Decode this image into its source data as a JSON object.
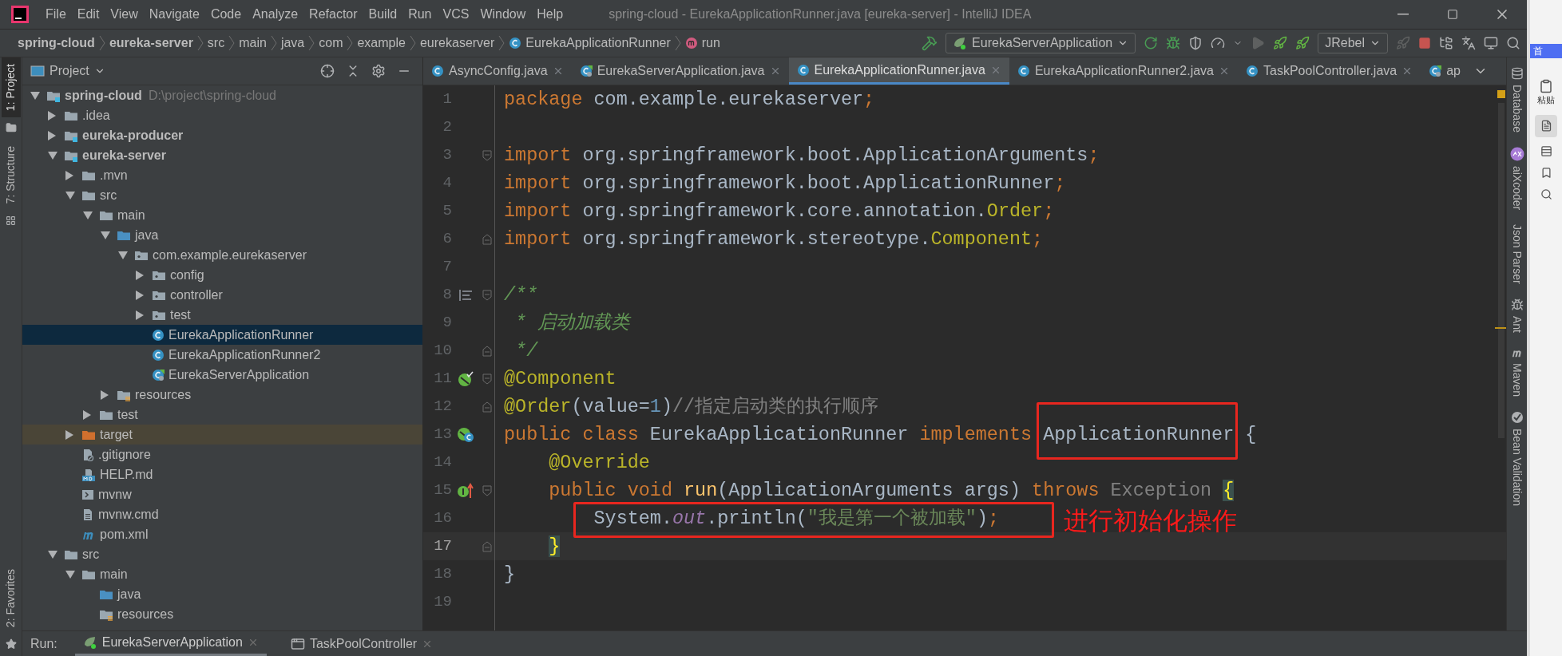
{
  "window": {
    "title": "spring-cloud - EurekaApplicationRunner.java [eureka-server] - IntelliJ IDEA"
  },
  "menu": [
    "File",
    "Edit",
    "View",
    "Navigate",
    "Code",
    "Analyze",
    "Refactor",
    "Build",
    "Run",
    "VCS",
    "Window",
    "Help"
  ],
  "breadcrumbs": [
    {
      "label": "spring-cloud",
      "kind": "module"
    },
    {
      "label": "eureka-server",
      "kind": "module"
    },
    {
      "label": "src",
      "kind": "dir"
    },
    {
      "label": "main",
      "kind": "dir"
    },
    {
      "label": "java",
      "kind": "dir"
    },
    {
      "label": "com",
      "kind": "dir"
    },
    {
      "label": "example",
      "kind": "dir"
    },
    {
      "label": "eurekaserver",
      "kind": "dir"
    },
    {
      "label": "EurekaApplicationRunner",
      "kind": "class"
    },
    {
      "label": "run",
      "kind": "method"
    }
  ],
  "toolbar": {
    "run_config": "EurekaServerApplication",
    "jrebel": "JRebel"
  },
  "left_strip": {
    "top": [
      {
        "label": "1: Project",
        "kind": "project",
        "selected": true
      },
      {
        "label": "7: Structure",
        "kind": "structure",
        "selected": false
      }
    ],
    "bottom": [
      {
        "label": "2: Favorites",
        "kind": "favorites",
        "selected": false
      }
    ]
  },
  "project_panel": {
    "title": "Project",
    "tree": [
      {
        "label": "spring-cloud",
        "hint": "D:\\project\\spring-cloud",
        "kind": "module",
        "expanded": true,
        "selected": false,
        "children": [
          {
            "label": ".idea",
            "kind": "folder",
            "expanded": false,
            "selected": false
          },
          {
            "label": "eureka-producer",
            "kind": "module",
            "expanded": false,
            "selected": false
          },
          {
            "label": "eureka-server",
            "kind": "module",
            "expanded": true,
            "selected": false,
            "children": [
              {
                "label": ".mvn",
                "kind": "folder",
                "expanded": false,
                "selected": false
              },
              {
                "label": "src",
                "kind": "folder",
                "expanded": true,
                "selected": false,
                "children": [
                  {
                    "label": "main",
                    "kind": "folder",
                    "expanded": true,
                    "selected": false,
                    "children": [
                      {
                        "label": "java",
                        "kind": "source",
                        "expanded": true,
                        "selected": false,
                        "children": [
                          {
                            "label": "com.example.eurekaserver",
                            "kind": "package",
                            "expanded": true,
                            "selected": false,
                            "children": [
                              {
                                "label": "config",
                                "kind": "package",
                                "expanded": false,
                                "selected": false
                              },
                              {
                                "label": "controller",
                                "kind": "package",
                                "expanded": false,
                                "selected": false
                              },
                              {
                                "label": "test",
                                "kind": "package",
                                "expanded": false,
                                "selected": false
                              },
                              {
                                "label": "EurekaApplicationRunner",
                                "kind": "class",
                                "selected": true
                              },
                              {
                                "label": "EurekaApplicationRunner2",
                                "kind": "class",
                                "selected": false
                              },
                              {
                                "label": "EurekaServerApplication",
                                "kind": "spring",
                                "selected": false
                              }
                            ]
                          }
                        ]
                      },
                      {
                        "label": "resources",
                        "kind": "resources",
                        "expanded": false,
                        "selected": false
                      }
                    ]
                  },
                  {
                    "label": "test",
                    "kind": "folder",
                    "expanded": false,
                    "selected": false
                  }
                ]
              },
              {
                "label": "target",
                "kind": "target",
                "expanded": false,
                "selected": false
              },
              {
                "label": ".gitignore",
                "kind": "gitignore",
                "selected": false
              },
              {
                "label": "HELP.md",
                "kind": "markdown",
                "selected": false
              },
              {
                "label": "mvnw",
                "kind": "script",
                "selected": false
              },
              {
                "label": "mvnw.cmd",
                "kind": "textfile",
                "selected": false
              },
              {
                "label": "pom.xml",
                "kind": "maven",
                "selected": false
              }
            ]
          },
          {
            "label": "src",
            "kind": "folder",
            "expanded": true,
            "selected": false,
            "children": [
              {
                "label": "main",
                "kind": "folder",
                "expanded": true,
                "selected": false,
                "children": [
                  {
                    "label": "java",
                    "kind": "source",
                    "selected": false
                  },
                  {
                    "label": "resources",
                    "kind": "resources",
                    "selected": false
                  }
                ]
              }
            ]
          }
        ]
      }
    ]
  },
  "editor_tabs": [
    {
      "label": "AsyncConfig.java",
      "kind": "class",
      "selected": false,
      "closable": true
    },
    {
      "label": "EurekaServerApplication.java",
      "kind": "spring",
      "selected": false,
      "closable": true
    },
    {
      "label": "EurekaApplicationRunner.java",
      "kind": "class",
      "selected": true,
      "closable": true
    },
    {
      "label": "EurekaApplicationRunner2.java",
      "kind": "class",
      "selected": false,
      "closable": true
    },
    {
      "label": "TaskPoolController.java",
      "kind": "class",
      "selected": false,
      "closable": true
    },
    {
      "label": "ap",
      "kind": "spring",
      "selected": false,
      "closable": false
    }
  ],
  "code_lines": [
    {
      "number": "1",
      "current": false,
      "tokens": [
        {
          "text": "package ",
          "kind": "keyword"
        },
        {
          "text": "com.example.eurekaserver",
          "kind": "plain"
        },
        {
          "text": ";",
          "kind": "keyword"
        }
      ]
    },
    {
      "number": "2",
      "current": false
    },
    {
      "number": "3",
      "fold": {
        "kind": "start"
      },
      "current": false,
      "tokens": [
        {
          "text": "import ",
          "kind": "keyword"
        },
        {
          "text": "org.springframework.boot.ApplicationArguments",
          "kind": "plain"
        },
        {
          "text": ";",
          "kind": "keyword"
        }
      ]
    },
    {
      "number": "4",
      "current": false,
      "tokens": [
        {
          "text": "import ",
          "kind": "keyword"
        },
        {
          "text": "org.springframework.boot.ApplicationRunner",
          "kind": "plain"
        },
        {
          "text": ";",
          "kind": "keyword"
        }
      ]
    },
    {
      "number": "5",
      "current": false,
      "tokens": [
        {
          "text": "import ",
          "kind": "keyword"
        },
        {
          "text": "org.springframework.core.annotation.",
          "kind": "plain"
        },
        {
          "text": "Order",
          "kind": "annotation"
        },
        {
          "text": ";",
          "kind": "keyword"
        }
      ]
    },
    {
      "number": "6",
      "fold": {
        "kind": "end"
      },
      "current": false,
      "tokens": [
        {
          "text": "import ",
          "kind": "keyword"
        },
        {
          "text": "org.springframework.stereotype.",
          "kind": "plain"
        },
        {
          "text": "Component",
          "kind": "annotation"
        },
        {
          "text": ";",
          "kind": "keyword"
        }
      ]
    },
    {
      "number": "7",
      "current": false
    },
    {
      "number": "8",
      "gutter_icon": {
        "kind": "doc"
      },
      "fold": {
        "kind": "start"
      },
      "current": false,
      "tokens": [
        {
          "text": "/**",
          "kind": "doc"
        }
      ]
    },
    {
      "number": "9",
      "current": false,
      "tokens": [
        {
          "text": " * 启动加载类",
          "kind": "doc"
        }
      ]
    },
    {
      "number": "10",
      "fold": {
        "kind": "end"
      },
      "current": false,
      "tokens": [
        {
          "text": " */",
          "kind": "doc"
        }
      ]
    },
    {
      "number": "11",
      "gutter_icon": {
        "kind": "bean"
      },
      "fold": {
        "kind": "start"
      },
      "current": false,
      "tokens": [
        {
          "text": "@Component",
          "kind": "annotation"
        }
      ]
    },
    {
      "number": "12",
      "fold": {
        "kind": "end"
      },
      "current": false,
      "tokens": [
        {
          "text": "@Order",
          "kind": "annotation"
        },
        {
          "text": "(value=",
          "kind": "plain"
        },
        {
          "text": "1",
          "kind": "number"
        },
        {
          "text": ")",
          "kind": "plain"
        },
        {
          "text": "//指定启动类的执行顺序",
          "kind": "comment"
        }
      ]
    },
    {
      "number": "13",
      "gutter_icon": {
        "kind": "bean-class"
      },
      "current": false,
      "tokens": [
        {
          "text": "public class ",
          "kind": "keyword"
        },
        {
          "text": "EurekaApplicationRunner ",
          "kind": "plain"
        },
        {
          "text": "implements ",
          "kind": "keyword"
        },
        {
          "text": "ApplicationRunner {",
          "kind": "plain"
        }
      ]
    },
    {
      "number": "14",
      "current": false,
      "tokens": [
        {
          "text": "    @Override",
          "kind": "annotation"
        }
      ]
    },
    {
      "number": "15",
      "gutter_icon": {
        "kind": "override"
      },
      "fold": {
        "kind": "start"
      },
      "current": false,
      "tokens": [
        {
          "text": "    public void ",
          "kind": "keyword"
        },
        {
          "text": "run",
          "kind": "method"
        },
        {
          "text": "(ApplicationArguments args) ",
          "kind": "plain"
        },
        {
          "text": "throws ",
          "kind": "keyword"
        },
        {
          "text": "Exception ",
          "kind": "unused"
        },
        {
          "text": "{",
          "kind": "brace"
        }
      ]
    },
    {
      "number": "16",
      "current": false,
      "tokens": [
        {
          "text": "        System.",
          "kind": "plain"
        },
        {
          "text": "out",
          "kind": "static"
        },
        {
          "text": ".println(",
          "kind": "plain"
        },
        {
          "text": "\"我是第一个被加载\"",
          "kind": "string"
        },
        {
          "text": ")",
          "kind": "plain"
        },
        {
          "text": ";",
          "kind": "keyword"
        }
      ]
    },
    {
      "number": "17",
      "fold": {
        "kind": "end"
      },
      "current": true,
      "tokens": [
        {
          "text": "    }",
          "kind": "brace"
        }
      ]
    },
    {
      "number": "18",
      "current": false,
      "tokens": [
        {
          "text": "}",
          "kind": "plain"
        }
      ]
    },
    {
      "number": "19",
      "current": false
    }
  ],
  "annotation": {
    "text": "进行初始化操作"
  },
  "right_strip": [
    {
      "label": "Database",
      "kind": "database"
    },
    {
      "label": "aiXcoder",
      "kind": "aixcoder"
    },
    {
      "label": "Json Parser",
      "kind": "plain"
    },
    {
      "label": "Ant",
      "kind": "ant"
    },
    {
      "label": "Maven",
      "kind": "maven"
    },
    {
      "label": "Bean Validation",
      "kind": "bean"
    }
  ],
  "run_bar": {
    "label": "Run:",
    "tabs": [
      {
        "label": "EurekaServerApplication",
        "kind": "spring",
        "selected": true
      },
      {
        "label": "TaskPoolController",
        "kind": "window",
        "selected": false
      }
    ]
  },
  "side_app": {
    "tab": "首",
    "paste": "粘贴"
  }
}
